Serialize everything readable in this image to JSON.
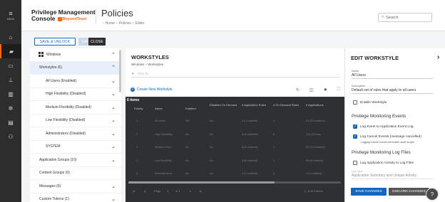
{
  "rail": {
    "menu_label": "MENU",
    "items": [
      {
        "icon": "home-icon",
        "symbol": "⌂"
      },
      {
        "icon": "policy-icon",
        "symbol": "▰",
        "active": true
      },
      {
        "icon": "computers-icon",
        "symbol": "▭"
      },
      {
        "icon": "groups-icon",
        "symbol": "⊥"
      },
      {
        "icon": "analytics-icon",
        "symbol": "▥"
      },
      {
        "icon": "settings-icon",
        "symbol": "✲"
      },
      {
        "icon": "clipboard-icon",
        "symbol": "▤"
      },
      {
        "icon": "user-add-icon",
        "symbol": "⚇"
      }
    ]
  },
  "header": {
    "brand_line1": "Privilege Management",
    "brand_line2": "Console",
    "brand_logo": "BeyondTrust",
    "page_title": "Policies",
    "breadcrumb": [
      "Home",
      "Policies",
      "Editor"
    ],
    "search_placeholder": "Search"
  },
  "toolbar": {
    "save_unlock": "SAVE & UNLOCK",
    "save": "SAVE",
    "close": "CLOSE"
  },
  "tree": [
    {
      "label": "Windows",
      "level": 0,
      "chevron": "^",
      "icon": true
    },
    {
      "label": "Workstyles (6)",
      "level": 1,
      "chevron": "^",
      "selected": true
    },
    {
      "label": "All Users (Enabled)",
      "level": 2,
      "chevron": "v"
    },
    {
      "label": "High Flexibility (Disabled)",
      "level": 2,
      "chevron": "v"
    },
    {
      "label": "Medium Flexibility (Disabled)",
      "level": 2,
      "chevron": "v"
    },
    {
      "label": "Low Flexibility (Disabled)",
      "level": 2,
      "chevron": "v"
    },
    {
      "label": "Administrators (Disabled)",
      "level": 2,
      "chevron": "v"
    },
    {
      "label": "SYSTEM",
      "level": 2,
      "chevron": "v"
    },
    {
      "label": "Application Groups (10)",
      "level": 1,
      "chevron": "v"
    },
    {
      "label": "Content Groups (0)",
      "level": 1,
      "chevron": ""
    },
    {
      "label": "Messages (6)",
      "level": 1,
      "chevron": "v"
    },
    {
      "label": "Custom Tokens (1)",
      "level": 1,
      "chevron": "v"
    }
  ],
  "main": {
    "title": "WORKSTYLES",
    "breadcrumb": "Windows – Workstyles",
    "filter_placeholder": "Filter by",
    "create_label": "Create New Workstyle",
    "items_count": "6 items",
    "columns": [
      "Priority",
      "Name",
      "Enabled",
      "Disabled On Demand",
      "# Application Rules",
      "# On Demand Rules",
      "# Applications"
    ],
    "rows": [
      [
        "1",
        "All Users",
        "Yes",
        "No",
        "0 (0 enabled)",
        "1",
        "24 (23 enabled)"
      ],
      [
        "2",
        "High Flexibility",
        "No",
        "No",
        "8 (8 enabled)",
        "8",
        "110 (13 ena..."
      ],
      [
        "3",
        "Medium Flexi...",
        "No",
        "No",
        "8 (8 enabled)",
        "1",
        "62 (13 enabled)"
      ],
      [
        "4",
        "Low Flexibility",
        "No",
        "No",
        "8 (8 enabled)",
        "1",
        "66 (8 enabled)"
      ],
      [
        "5",
        "Administrators",
        "No",
        "No",
        "2 (2 enabled)",
        "0",
        "2 (2 enabled)"
      ],
      [
        "6",
        "SYSTEM",
        "No",
        "No",
        "1 (1 enabled)",
        "0",
        "1 (1 enabled)"
      ]
    ],
    "pager": {
      "page_label": "Page",
      "page": "1",
      "of": "of 1",
      "range": "1 - 6 of 6 items"
    }
  },
  "edit": {
    "title": "EDIT WORKSTYLE",
    "name_label": "Name",
    "name_value": "All Users",
    "desc_label": "Description",
    "desc_value": "Default set of rules that apply to all users",
    "enable_label": "Enable Workstyle",
    "enable_checked": false,
    "monitoring_title": "Privilege Monitoring Events",
    "log_app_event": "Log Event to Application Event Log",
    "log_app_event_checked": true,
    "log_cancel": "Log Cancel Events (message cancelled)",
    "log_cancel_checked": true,
    "log_cancel_note": "Logging Cancel events will enable audit scripts",
    "logfiles_title": "Privilege Monitoring Log Files",
    "log_activity": "Log Application Activity to Log Files",
    "log_activity_checked": false,
    "log_type_label": "Log Type",
    "log_type_value": "Application Summary and Unique Activity",
    "save_changes": "SAVE CHANGES",
    "discard_changes": "DISCARD CHANGES"
  },
  "colors": {
    "accent": "#1565c0",
    "brand": "#ff6600",
    "rail": "#2d2d2d",
    "grid": "#2f3033"
  }
}
